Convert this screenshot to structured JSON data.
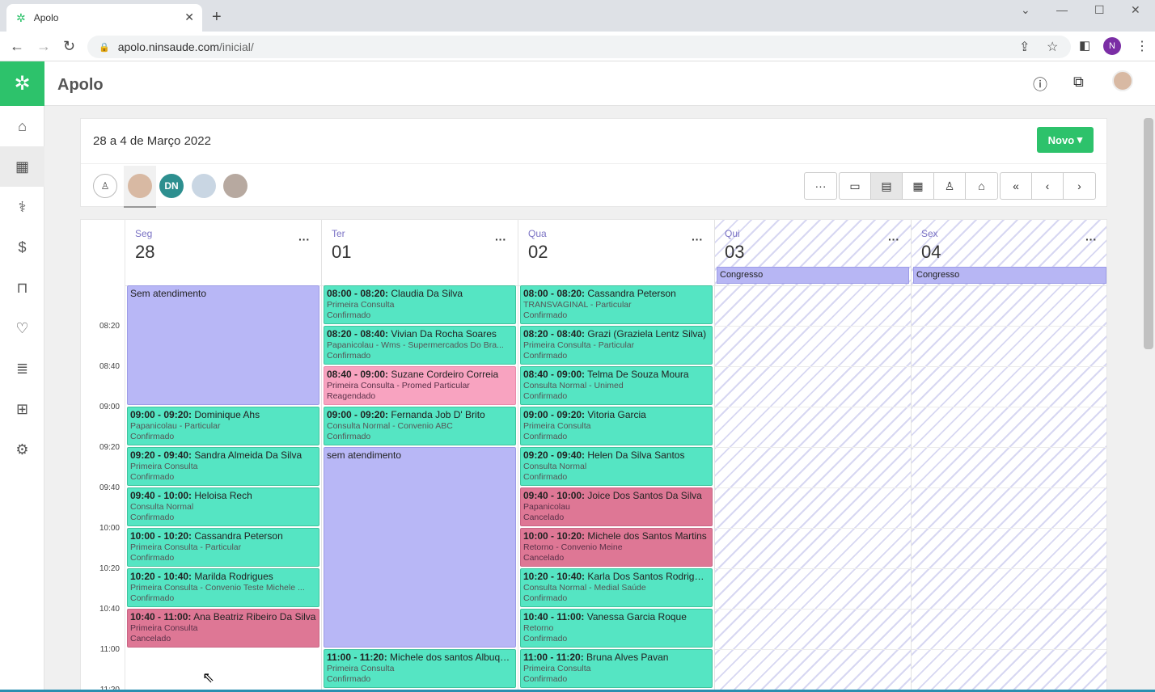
{
  "browser": {
    "tab_title": "Apolo",
    "url_host": "apolo.ninsaude.com",
    "url_path": "/inicial/",
    "profile_initial": "N"
  },
  "app": {
    "title": "Apolo",
    "brand_color": "#2dc26b"
  },
  "sidebar": {
    "items": [
      {
        "icon": "home-icon"
      },
      {
        "icon": "calendar-icon",
        "active": true
      },
      {
        "icon": "stethoscope-icon"
      },
      {
        "icon": "dollar-icon"
      },
      {
        "icon": "shopping-bag-icon"
      },
      {
        "icon": "heartbeat-icon"
      },
      {
        "icon": "report-icon"
      },
      {
        "icon": "grid-icon"
      },
      {
        "icon": "gear-icon"
      }
    ]
  },
  "toolbar": {
    "date_range": "28 a 4 de Março 2022",
    "new_button": "Novo",
    "professional_initials": "DN"
  },
  "calendar": {
    "time_labels": [
      "08:20",
      "08:40",
      "09:00",
      "09:20",
      "09:40",
      "10:00",
      "10:20",
      "10:40",
      "11:00",
      "11:20"
    ],
    "days": [
      {
        "name": "Seg",
        "num": "28",
        "allday": ""
      },
      {
        "name": "Ter",
        "num": "01",
        "allday": ""
      },
      {
        "name": "Qua",
        "num": "02",
        "allday": ""
      },
      {
        "name": "Qui",
        "num": "03",
        "allday": "Congresso"
      },
      {
        "name": "Sex",
        "num": "04",
        "allday": "Congresso"
      }
    ],
    "events": {
      "seg": [
        {
          "time": "",
          "name": "Sem atendimento",
          "line2": "",
          "line3": ""
        },
        {
          "time": "09:00 - 09:20:",
          "name": " Dominique Ahs",
          "line2": "Papanicolau - Particular",
          "line3": "Confirmado"
        },
        {
          "time": "09:20 - 09:40:",
          "name": " Sandra Almeida Da Silva",
          "line2": "Primeira Consulta",
          "line3": "Confirmado"
        },
        {
          "time": "09:40 - 10:00:",
          "name": " Heloisa Rech",
          "line2": "Consulta Normal",
          "line3": "Confirmado"
        },
        {
          "time": "10:00 - 10:20:",
          "name": " Cassandra Peterson",
          "line2": "Primeira Consulta - Particular",
          "line3": "Confirmado"
        },
        {
          "time": "10:20 - 10:40:",
          "name": " Marilda Rodrigues",
          "line2": "Primeira Consulta - Convenio Teste Michele ...",
          "line3": "Confirmado"
        },
        {
          "time": "10:40 - 11:00:",
          "name": " Ana Beatriz Ribeiro Da Silva",
          "line2": "Primeira Consulta",
          "line3": "Cancelado"
        }
      ],
      "ter": [
        {
          "time": "08:00 - 08:20:",
          "name": " Claudia Da Silva",
          "line2": "Primeira Consulta",
          "line3": "Confirmado"
        },
        {
          "time": "08:20 - 08:40:",
          "name": " Vivian Da Rocha Soares",
          "line2": "Papanicolau - Wms - Supermercados Do Bra...",
          "line3": "Confirmado"
        },
        {
          "time": "08:40 - 09:00:",
          "name": " Suzane Cordeiro Correia",
          "line2": "Primeira Consulta - Promed Particular",
          "line3": "Reagendado"
        },
        {
          "time": "09:00 - 09:20:",
          "name": " Fernanda Job D' Brito",
          "line2": "Consulta Normal - Convenio ABC",
          "line3": "Confirmado"
        },
        {
          "time": "",
          "name": "sem atendimento",
          "line2": "",
          "line3": ""
        },
        {
          "time": "11:00 - 11:20:",
          "name": " Michele dos santos Albuqu...",
          "line2": "Primeira Consulta",
          "line3": "Confirmado"
        }
      ],
      "qua": [
        {
          "time": "08:00 - 08:20:",
          "name": " Cassandra Peterson",
          "line2": "TRANSVAGINAL - Particular",
          "line3": "Confirmado"
        },
        {
          "time": "08:20 - 08:40:",
          "name": " Grazi (Graziela Lentz Silva)",
          "line2": "Primeira Consulta - Particular",
          "line3": "Confirmado"
        },
        {
          "time": "08:40 - 09:00:",
          "name": " Telma De Souza Moura",
          "line2": "Consulta Normal - Unimed",
          "line3": "Confirmado"
        },
        {
          "time": "09:00 - 09:20:",
          "name": " Vitoria Garcia",
          "line2": "Primeira Consulta",
          "line3": "Confirmado"
        },
        {
          "time": "09:20 - 09:40:",
          "name": " Helen Da Silva Santos",
          "line2": "Consulta Normal",
          "line3": "Confirmado"
        },
        {
          "time": "09:40 - 10:00:",
          "name": " Joice Dos Santos Da Silva",
          "line2": "Papanicolau",
          "line3": "Cancelado"
        },
        {
          "time": "10:00 - 10:20:",
          "name": " Michele dos Santos Martins",
          "line2": "Retorno - Convenio Meine",
          "line3": "Cancelado"
        },
        {
          "time": "10:20 - 10:40:",
          "name": " Karla Dos Santos Rodrigues",
          "line2": "Consulta Normal - Medial Saúde",
          "line3": "Confirmado"
        },
        {
          "time": "10:40 - 11:00:",
          "name": " Vanessa Garcia Roque",
          "line2": "Retorno",
          "line3": "Confirmado"
        },
        {
          "time": "11:00 - 11:20:",
          "name": " Bruna Alves Pavan",
          "line2": "Primeira Consulta",
          "line3": "Confirmado"
        }
      ]
    }
  }
}
